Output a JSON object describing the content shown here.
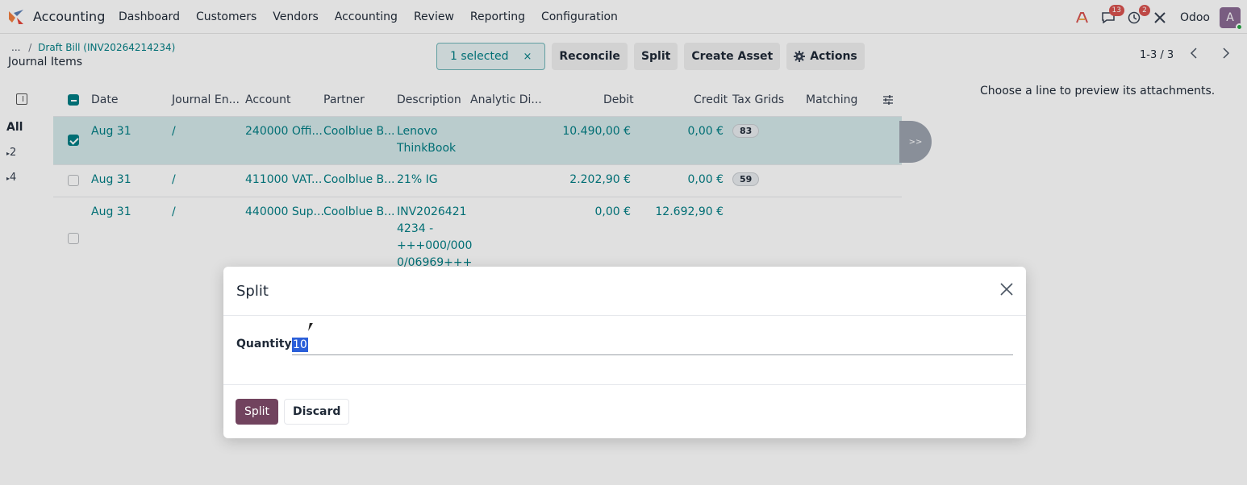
{
  "app": {
    "name": "Accounting",
    "menu": [
      "Dashboard",
      "Customers",
      "Vendors",
      "Accounting",
      "Review",
      "Reporting",
      "Configuration"
    ],
    "systray": {
      "messages_badge": "13",
      "activities_badge": "2",
      "company": "Odoo",
      "avatar_letter": "A"
    }
  },
  "control_panel": {
    "breadcrumb_dots": "...",
    "breadcrumb_sep": "/",
    "breadcrumb_parent": "Draft Bill (INV20264214234)",
    "title": "Journal Items",
    "selected_label": "1 selected",
    "selected_clear": "×",
    "buttons": [
      "Reconcile",
      "Split",
      "Create Asset",
      "Actions"
    ],
    "pager": "1-3 / 3"
  },
  "side_panel": {
    "all": "All",
    "groups": [
      "2",
      "4"
    ]
  },
  "table": {
    "headers": [
      "Date",
      "Journal En...",
      "Account",
      "Partner",
      "Description",
      "Analytic Di...",
      "Debit",
      "Credit",
      "Tax Grids",
      "Matching"
    ],
    "rows": [
      {
        "date": "Aug 31",
        "journal": "/",
        "account": "240000 Offi...",
        "partner": "Coolblue B...",
        "desc_1": "Lenovo",
        "desc_2": "ThinkBook",
        "desc_3": "",
        "desc_4": "",
        "debit": "10.490,00 €",
        "credit": "0,00 €",
        "tax": "83",
        "selected": true
      },
      {
        "date": "Aug 31",
        "journal": "/",
        "account": "411000 VAT...",
        "partner": "Coolblue B...",
        "desc_1": "21% IG",
        "desc_2": "",
        "desc_3": "",
        "desc_4": "",
        "debit": "2.202,90 €",
        "credit": "0,00 €",
        "tax": "59",
        "selected": false
      },
      {
        "date": "Aug 31",
        "journal": "/",
        "account": "440000 Sup...",
        "partner": "Coolblue B...",
        "desc_1": "INV2026421",
        "desc_2": "4234 -",
        "desc_3": "+++000/000",
        "desc_4": "0/06969+++",
        "debit": "0,00 €",
        "credit": "12.692,90 €",
        "tax": "",
        "selected": false
      }
    ]
  },
  "preview": {
    "handle": ">>",
    "message": "Choose a line to preview its attachments."
  },
  "dialog": {
    "title": "Split",
    "field_label": "Quantity",
    "field_value": "10",
    "primary": "Split",
    "secondary": "Discard"
  },
  "colors": {
    "brand": "#71435e",
    "link": "#017e84",
    "badge": "#d9534f"
  }
}
